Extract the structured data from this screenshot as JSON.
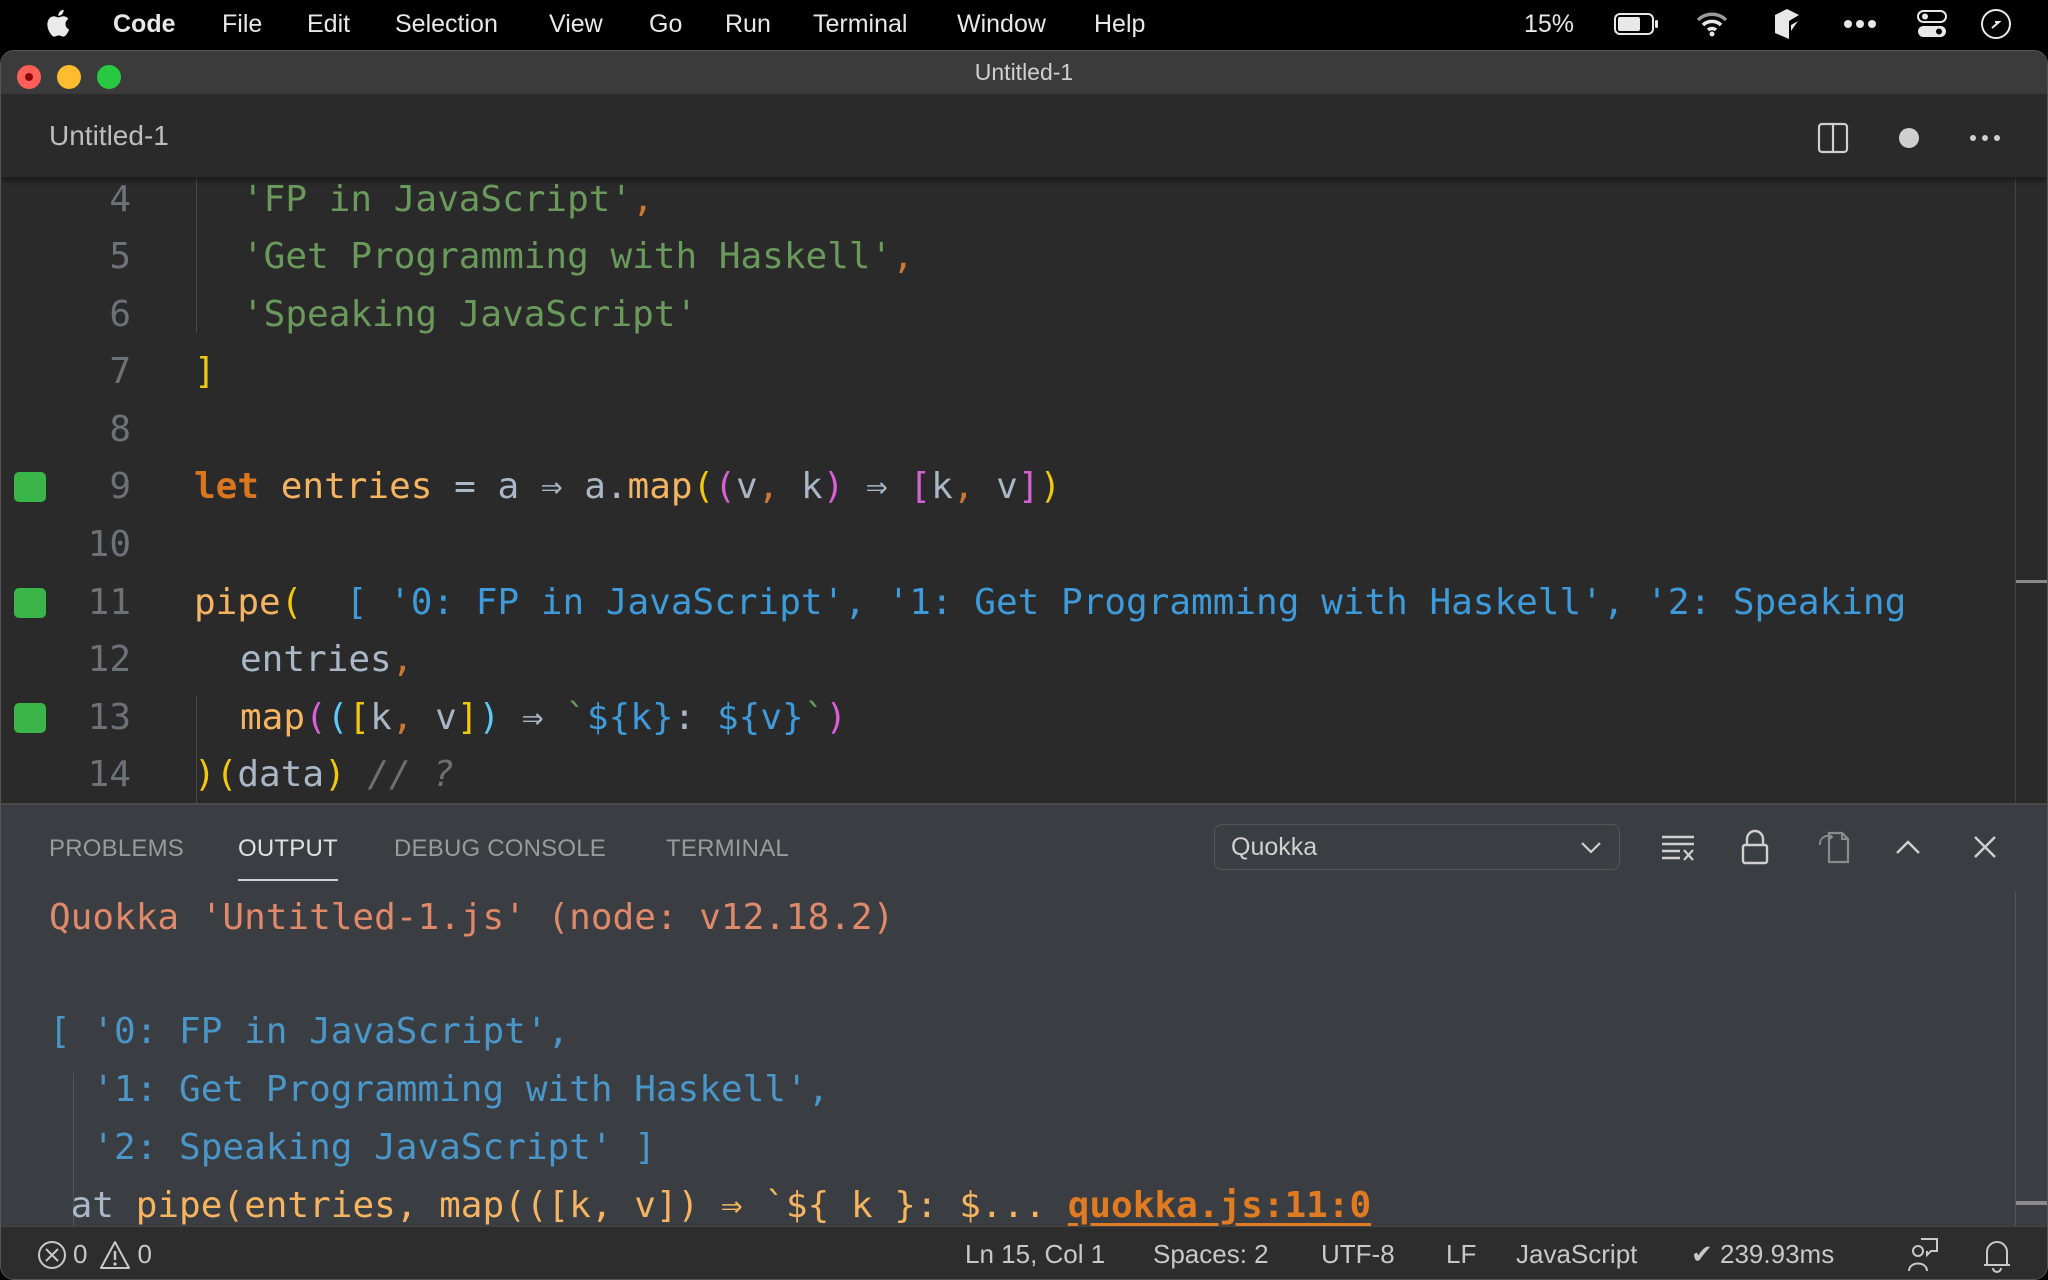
{
  "menubar": {
    "app_name": "Code",
    "items": [
      "File",
      "Edit",
      "Selection",
      "View",
      "Go",
      "Run",
      "Terminal",
      "Window",
      "Help"
    ],
    "battery_percent": "15%",
    "status_icons": [
      "battery-icon",
      "wifi-icon",
      "app-extension-icon",
      "more-icon",
      "control-center-icon",
      "clock-icon"
    ]
  },
  "window": {
    "title": "Untitled-1"
  },
  "tabbar": {
    "active_tab": "Untitled-1",
    "actions": [
      "split-editor-icon",
      "unsaved-dot-icon",
      "more-actions-icon"
    ]
  },
  "editor": {
    "lines": [
      {
        "number": "4",
        "marker": false,
        "text": "  'FP in JavaScript',"
      },
      {
        "number": "5",
        "marker": false,
        "text": "  'Get Programming with Haskell',"
      },
      {
        "number": "6",
        "marker": false,
        "text": "  'Speaking JavaScript'"
      },
      {
        "number": "7",
        "marker": false,
        "text": "]"
      },
      {
        "number": "8",
        "marker": false,
        "text": ""
      },
      {
        "number": "9",
        "marker": true,
        "text": "let entries = a ⇒ a.map((v, k) ⇒ [k, v])"
      },
      {
        "number": "10",
        "marker": false,
        "text": ""
      },
      {
        "number": "11",
        "marker": true,
        "text": "pipe(  [ '0: FP in JavaScript', '1: Get Programming with Haskell', '2: Speaking"
      },
      {
        "number": "12",
        "marker": false,
        "text": "  entries,"
      },
      {
        "number": "13",
        "marker": true,
        "text": "  map(([k, v]) ⇒ `${k}: ${v}`)"
      },
      {
        "number": "14",
        "marker": false,
        "text": ")(data) // ?"
      }
    ],
    "tokens": {
      "l4_str": "'FP in JavaScript'",
      "l5_str": "'Get Programming with Haskell'",
      "l6_str": "'Speaking JavaScript'",
      "l7_bracket": "]",
      "l9_kw": "let",
      "l9_name": "entries",
      "l9_eq": " = ",
      "l9_a": "a ",
      "l9_arrow": "⇒",
      "l9_amap": " a.",
      "l9_map": "map",
      "l9_params": "v, k",
      "l9_arrow2": " ⇒ ",
      "l9_kv_k": "k",
      "l9_kv_v": " v",
      "l11_fn": "pipe",
      "l11_inline": "[ '0: FP in JavaScript', '1: Get Programming with Haskell', '2: Speaking",
      "l12_text": "entries",
      "l13_fn": "map",
      "l13_k": "k",
      "l13_v": " v",
      "l13_arrow": " ⇒ ",
      "l13_tpl_k": "${k}",
      "l13_colon": ": ",
      "l13_tpl_v": "${v}",
      "l14_data": "data",
      "l14_comment": " // ?"
    }
  },
  "panel": {
    "tabs": [
      {
        "label": "PROBLEMS",
        "active": false
      },
      {
        "label": "OUTPUT",
        "active": true
      },
      {
        "label": "DEBUG CONSOLE",
        "active": false
      },
      {
        "label": "TERMINAL",
        "active": false
      }
    ],
    "output_channel": "Quokka",
    "actions": [
      "clear-output-icon",
      "lock-scroll-icon",
      "open-log-icon",
      "maximize-panel-icon",
      "close-panel-icon"
    ],
    "output_lines": {
      "header": "Quokka 'Untitled-1.js' (node: v12.18.2)",
      "result_1": "[ '0: FP in JavaScript',",
      "result_2": "  '1: Get Programming with Haskell',",
      "result_3": "  '2: Speaking JavaScript' ]",
      "at_prefix": " at ",
      "at_expr": "pipe(entries, map(([k, v]) ⇒ `${ k }: $...",
      "location_link": "quokka.js:11:0"
    }
  },
  "statusbar": {
    "errors": "0",
    "warnings": "0",
    "cursor": "Ln 15, Col 1",
    "indent": "Spaces: 2",
    "encoding": "UTF-8",
    "eol": "LF",
    "language": "JavaScript",
    "quokka_time": "✔ 239.93ms"
  },
  "colors": {
    "gutter_marker": "#3ab54a",
    "string": "#6a9a5b",
    "keyword": "#d9761f",
    "function": "#f5b461",
    "output_header": "#e0896a",
    "output_value": "#4b96c8",
    "link": "#e07b22"
  }
}
